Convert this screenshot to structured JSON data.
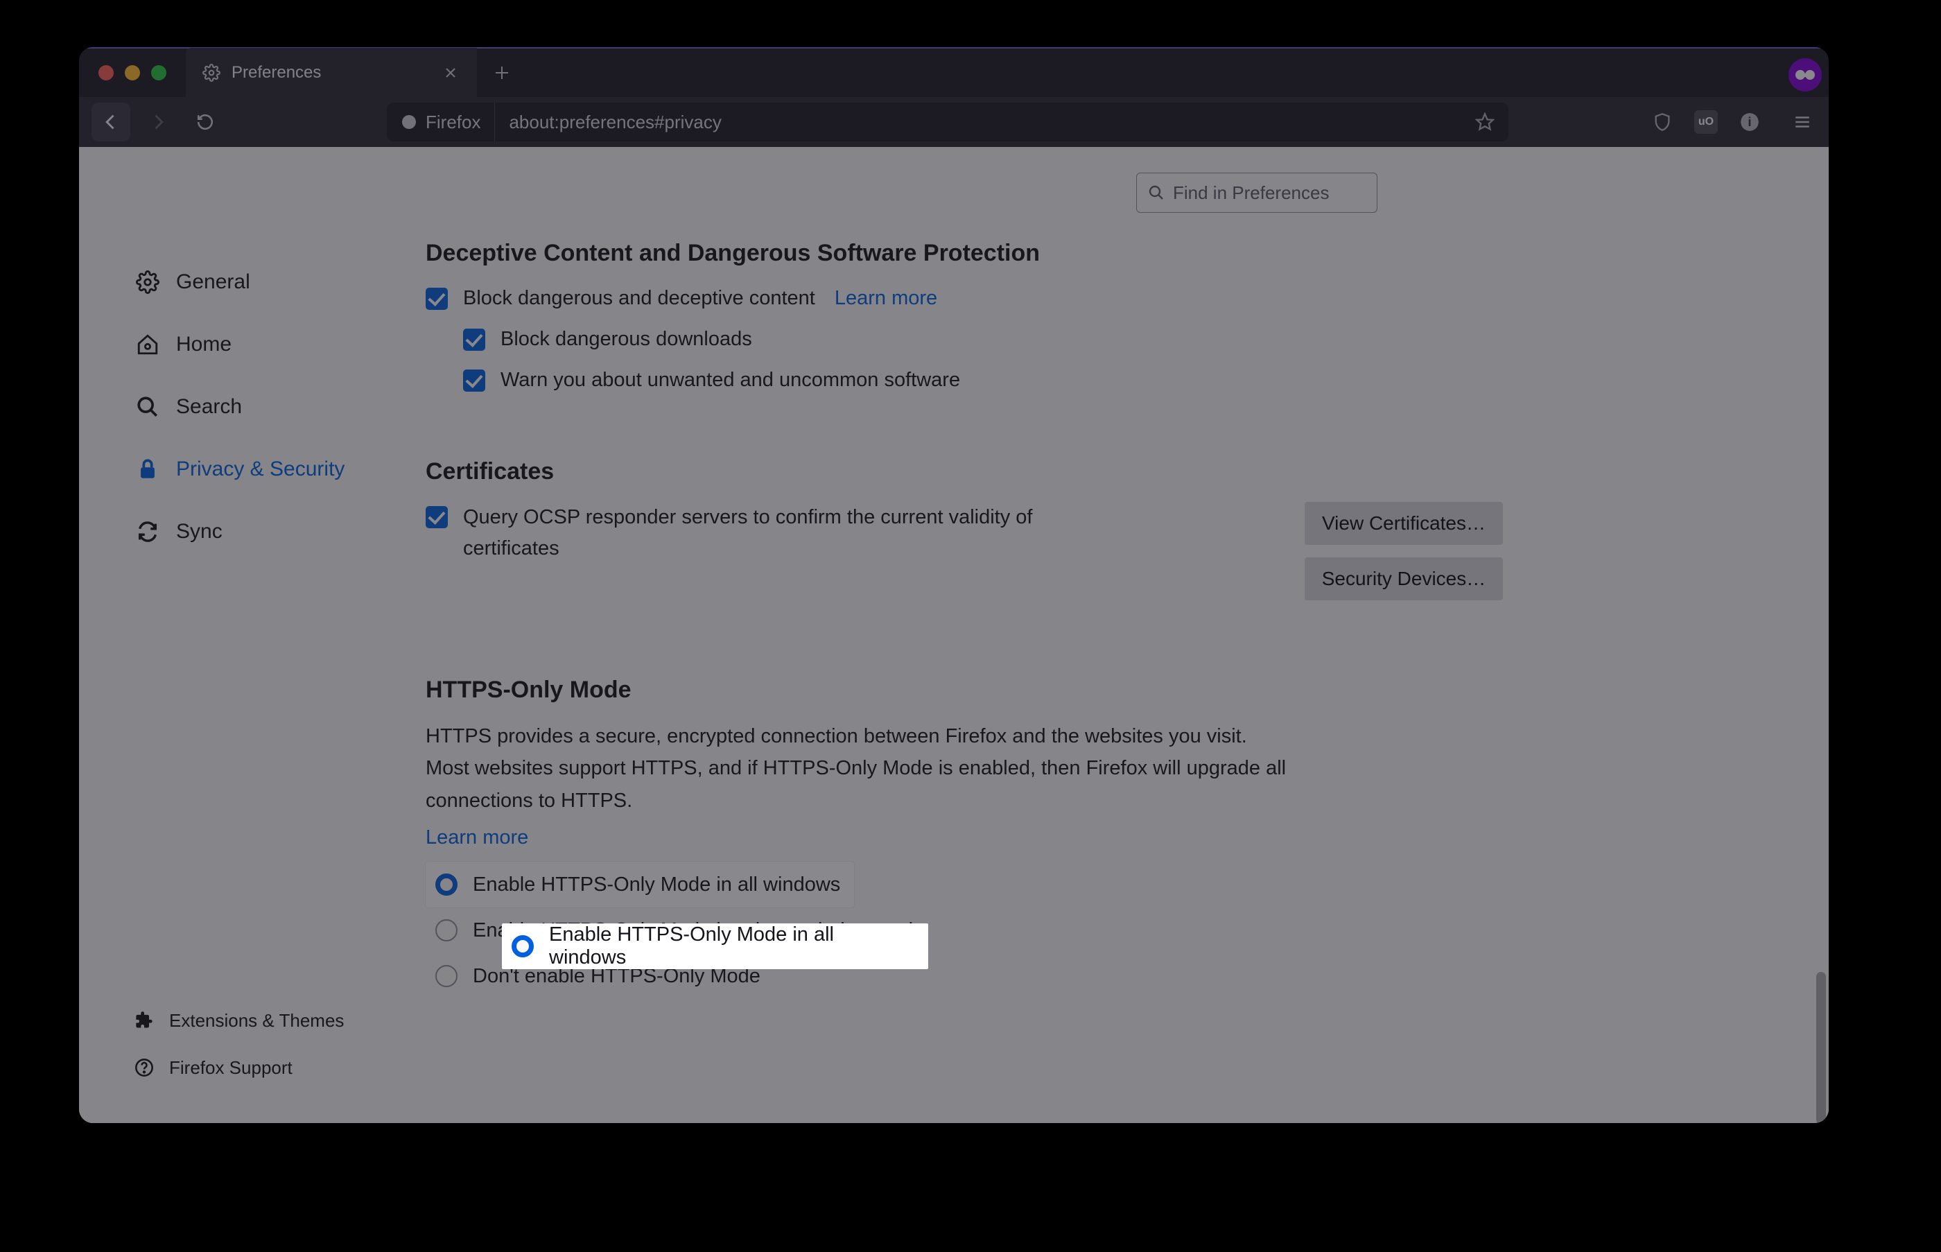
{
  "tab": {
    "title": "Preferences"
  },
  "url": {
    "identity": "Firefox",
    "path": "about:preferences#privacy"
  },
  "search": {
    "placeholder": "Find in Preferences"
  },
  "sidebar": {
    "items": [
      {
        "label": "General"
      },
      {
        "label": "Home"
      },
      {
        "label": "Search"
      },
      {
        "label": "Privacy & Security"
      },
      {
        "label": "Sync"
      }
    ],
    "bottom": [
      {
        "label": "Extensions & Themes"
      },
      {
        "label": "Firefox Support"
      }
    ]
  },
  "deceptive": {
    "title": "Deceptive Content and Dangerous Software Protection",
    "opt1": "Block dangerous and deceptive content",
    "learn": "Learn more",
    "opt2": "Block dangerous downloads",
    "opt3": "Warn you about unwanted and uncommon software"
  },
  "certs": {
    "title": "Certificates",
    "ocsp": "Query OCSP responder servers to confirm the current validity of certificates",
    "btn1": "View Certificates…",
    "btn2": "Security Devices…"
  },
  "https": {
    "title": "HTTPS-Only Mode",
    "desc": "HTTPS provides a secure, encrypted connection between Firefox and the websites you visit. Most websites support HTTPS, and if HTTPS-Only Mode is enabled, then Firefox will upgrade all connections to HTTPS.",
    "learn": "Learn more",
    "opt1": "Enable HTTPS-Only Mode in all windows",
    "opt2": "Enable HTTPS-Only Mode in private windows only",
    "opt3": "Don't enable HTTPS-Only Mode"
  }
}
